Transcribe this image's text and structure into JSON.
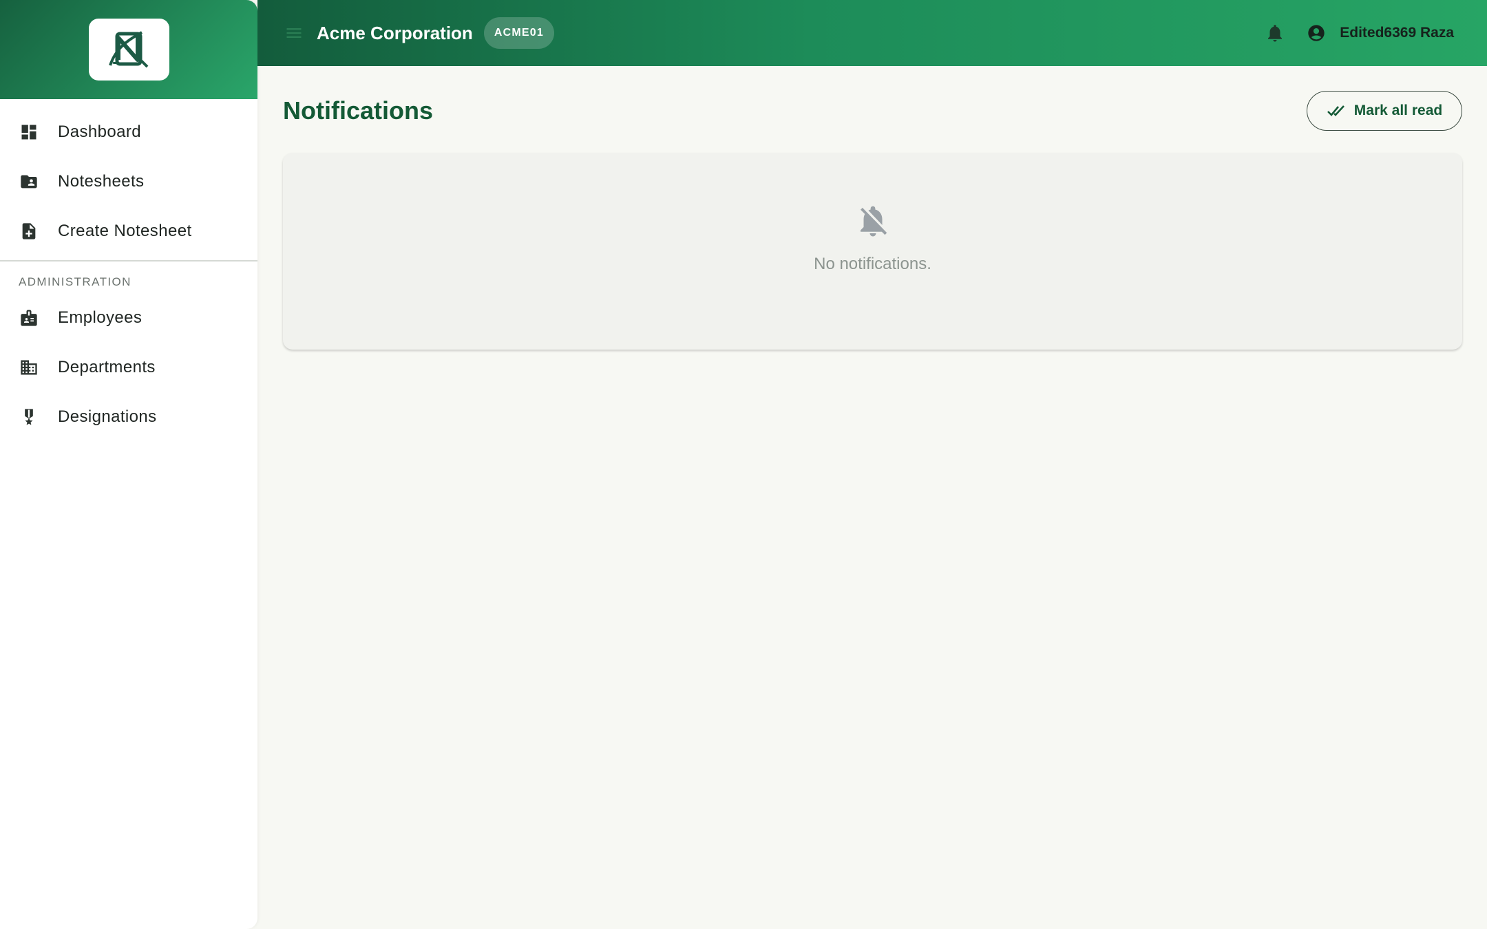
{
  "sidebar": {
    "logo_icon": "notesheet-logo-icon",
    "items": [
      {
        "label": "Dashboard",
        "icon": "dashboard-icon"
      },
      {
        "label": "Notesheets",
        "icon": "folder-user-icon"
      },
      {
        "label": "Create Notesheet",
        "icon": "file-add-icon"
      }
    ],
    "section_title": "ADMINISTRATION",
    "admin_items": [
      {
        "label": "Employees",
        "icon": "badge-icon"
      },
      {
        "label": "Departments",
        "icon": "building-icon"
      },
      {
        "label": "Designations",
        "icon": "medal-icon"
      }
    ]
  },
  "topbar": {
    "org_name": "Acme Corporation",
    "org_code": "ACME01",
    "user_name": "Edited6369 Raza"
  },
  "main": {
    "title": "Notifications",
    "mark_all_read_label": "Mark all read",
    "empty_text": "No notifications."
  },
  "colors": {
    "brand_dark": "#135c3c",
    "brand_light": "#2aa66a",
    "title_green": "#145a36",
    "background": "#f7f8f3"
  }
}
